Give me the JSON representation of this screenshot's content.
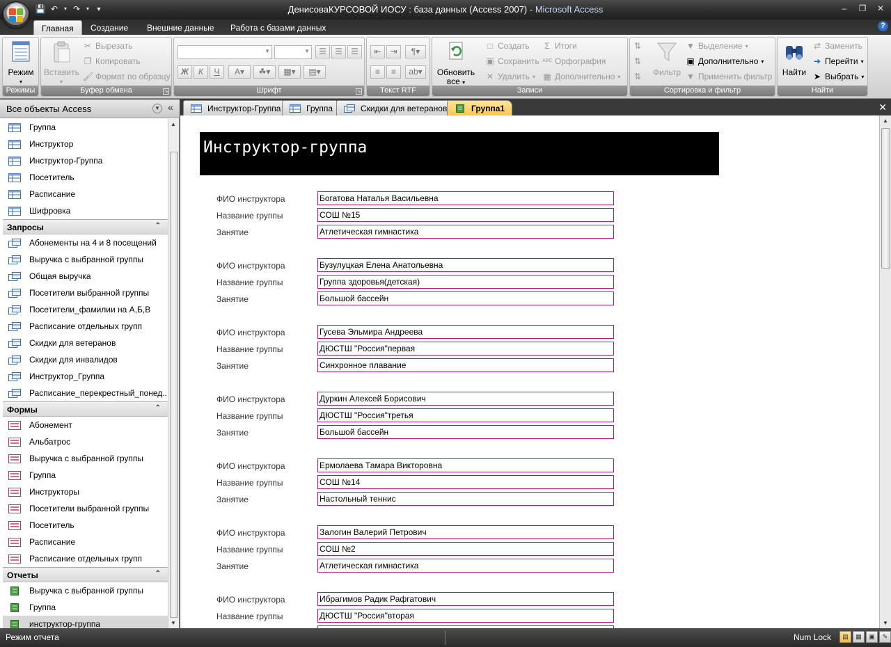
{
  "window": {
    "title": "ДенисоваКУРСОВОЙ ИОСУ : база данных (Access 2007)",
    "title_sep": " - ",
    "app_name": "Microsoft Access"
  },
  "ribbon": {
    "tabs": [
      "Главная",
      "Создание",
      "Внешние данные",
      "Работа с базами данных"
    ],
    "groups": {
      "modes": {
        "label": "Режимы",
        "view": "Режим"
      },
      "clipboard": {
        "label": "Буфер обмена",
        "paste": "Вставить",
        "cut": "Вырезать",
        "copy": "Копировать",
        "format_painter": "Формат по образцу"
      },
      "font": {
        "label": "Шрифт",
        "bold": "Ж",
        "italic": "К",
        "underline": "Ч"
      },
      "rtf": {
        "label": "Текст RTF"
      },
      "records": {
        "label": "Записи",
        "refresh": "Обновить",
        "refresh2": "все",
        "new": "Создать",
        "save": "Сохранить",
        "delete": "Удалить",
        "totals": "Итоги",
        "spelling": "Орфография",
        "more": "Дополнительно"
      },
      "sort": {
        "label": "Сортировка и фильтр",
        "filter": "Фильтр",
        "selection": "Выделение",
        "advanced": "Дополнительно",
        "toggle": "Применить фильтр"
      },
      "find": {
        "label": "Найти",
        "find": "Найти",
        "replace": "Заменить",
        "goto": "Перейти",
        "select": "Выбрать"
      }
    }
  },
  "nav": {
    "header": "Все объекты Access",
    "tables": [
      "Группа",
      "Инструктор",
      "Инструктор-Группа",
      "Посетитель",
      "Расписание",
      "Шифровка"
    ],
    "sections": {
      "queries": "Запросы",
      "forms": "Формы",
      "reports": "Отчеты"
    },
    "queries": [
      "Абонементы на 4 и 8 посещений",
      "Выручка с выбранной группы",
      "Общая выручка",
      "Посетители выбранной группы",
      "Посетители_фамилии на А,Б,В",
      "Расписание отдельных групп",
      "Скидки для ветеранов",
      "Скидки для инвалидов",
      "Инструктор_Группа",
      "Расписание_перекрестный_понед..."
    ],
    "forms": [
      "Абонемент",
      "Альбатрос",
      "Выручка с выбранной группы",
      "Группа",
      "Инструкторы",
      "Посетители выбранной группы",
      "Посетитель",
      "Расписание",
      "Расписание отдельных групп"
    ],
    "reports": [
      "Выручка с выбранной группы",
      "Группа",
      "инструктор-группа"
    ]
  },
  "doc_tabs": [
    "Инструктор-Группа",
    "Группа",
    "Скидки для ветеранов",
    "Группа1"
  ],
  "report": {
    "title": "Инструктор-группа",
    "labels": {
      "instructor": "ФИО инструктора",
      "group": "Название группы",
      "activity": "Занятие"
    },
    "records": [
      {
        "instructor": "Богатова Наталья Васильевна",
        "group": "СОШ №15",
        "activity": "Атлетическая гимнастика"
      },
      {
        "instructor": "Бузулуцкая Елена Анатольевна",
        "group": "Группа здоровья(детская)",
        "activity": "Большой бассейн"
      },
      {
        "instructor": "Гусева Эльмира Андреева",
        "group": "ДЮСТШ \"Россия\"первая",
        "activity": "Синхронное плавание"
      },
      {
        "instructor": "Дуркин Алексей Борисович",
        "group": "ДЮСТШ \"Россия\"третья",
        "activity": "Большой бассейн"
      },
      {
        "instructor": "Ермолаева Тамара Викторовна",
        "group": "СОШ №14",
        "activity": "Настольный теннис"
      },
      {
        "instructor": "Залогин  Валерий Петрович",
        "group": "СОШ №2",
        "activity": "Атлетическая гимнастика"
      },
      {
        "instructor": "Ибрагимов Радик Рафгатович",
        "group": "ДЮСТШ \"Россия\"вторая",
        "activity": ""
      }
    ]
  },
  "status": {
    "mode": "Режим отчета",
    "numlock": "Num Lock"
  },
  "colors": {
    "field_border": "#b01784",
    "active_tab": "#f9c74f",
    "title_bg": "#000000"
  }
}
